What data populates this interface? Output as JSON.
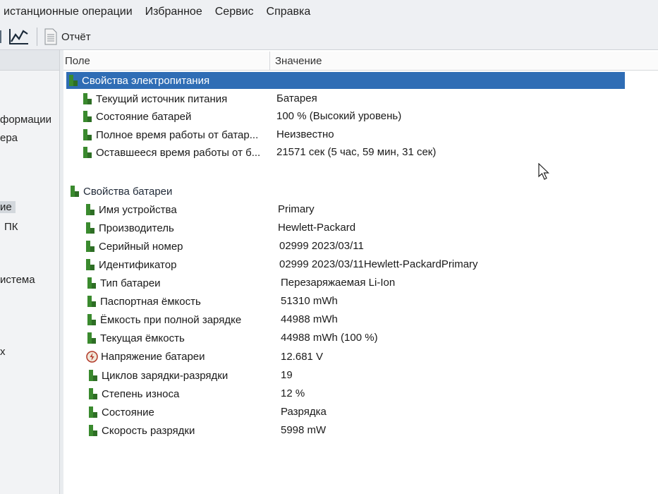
{
  "menu": [
    "истанционные операции",
    "Избранное",
    "Сервис",
    "Справка"
  ],
  "toolbar": {
    "report_label": "Отчёт"
  },
  "left_pane": {
    "items": [
      "формации",
      "ера",
      "ие",
      "ПК",
      "истема",
      "х"
    ]
  },
  "columns": {
    "field": "Поле",
    "value": "Значение"
  },
  "groups": [
    {
      "title": "Свойства электропитания",
      "rows": [
        {
          "field": "Текущий источник питания",
          "value": "Батарея"
        },
        {
          "field": "Состояние батарей",
          "value": "100 % (Высокий уровень)"
        },
        {
          "field": "Полное время работы от батар...",
          "value": "Неизвестно"
        },
        {
          "field": "Оставшееся время работы от б...",
          "value": "21571 сек (5 час, 59 мин, 31 сек)"
        }
      ]
    },
    {
      "title": "Свойства батареи",
      "rows": [
        {
          "field": "Имя устройства",
          "value": "Primary"
        },
        {
          "field": "Производитель",
          "value": "Hewlett-Packard"
        },
        {
          "field": "Серийный номер",
          "value": "02999 2023/03/11"
        },
        {
          "field": "Идентификатор",
          "value": "02999 2023/03/11Hewlett-PackardPrimary"
        },
        {
          "field": "Тип батареи",
          "value": "Перезаряжаемая Li-Ion"
        },
        {
          "field": "Паспортная ёмкость",
          "value": "51310 mWh"
        },
        {
          "field": "Ёмкость при полной зарядке",
          "value": "44988 mWh"
        },
        {
          "field": "Текущая ёмкость",
          "value": "44988 mWh  (100 %)"
        },
        {
          "field": "Напряжение батареи",
          "value": "12.681 V"
        },
        {
          "field": "Циклов зарядки-разрядки",
          "value": "19"
        },
        {
          "field": "Степень износа",
          "value": "12 %"
        },
        {
          "field": "Состояние",
          "value": "Разрядка"
        },
        {
          "field": "Скорость разрядки",
          "value": "5998 mW"
        }
      ]
    }
  ],
  "colors": {
    "selection": "#2f6db5",
    "battery_icon": "#3a8a2e",
    "voltage_icon": "#b23b2a"
  }
}
